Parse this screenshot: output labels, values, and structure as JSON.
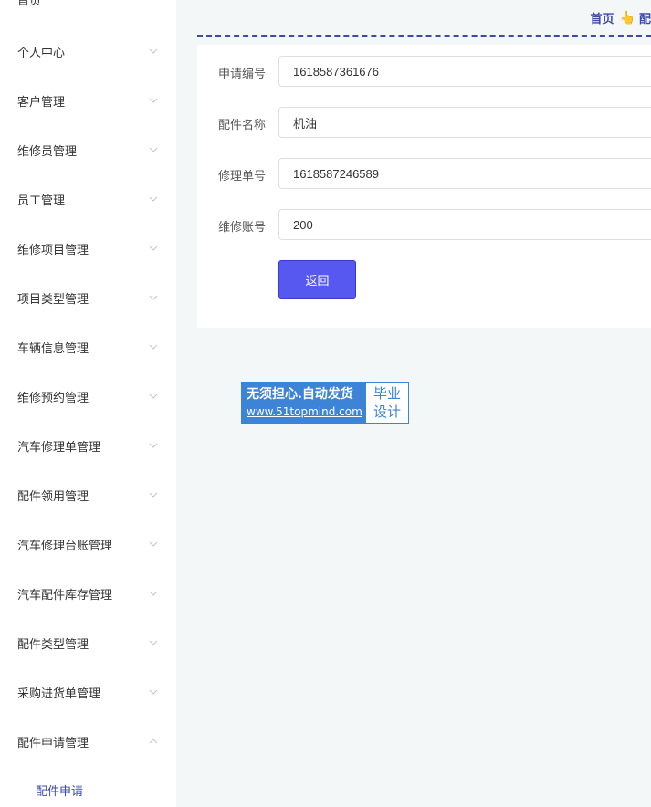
{
  "sidebar": {
    "top_label": "首页",
    "items": [
      {
        "label": "个人中心",
        "expanded": false
      },
      {
        "label": "客户管理",
        "expanded": false
      },
      {
        "label": "维修员管理",
        "expanded": false
      },
      {
        "label": "员工管理",
        "expanded": false
      },
      {
        "label": "维修项目管理",
        "expanded": false
      },
      {
        "label": "项目类型管理",
        "expanded": false
      },
      {
        "label": "车辆信息管理",
        "expanded": false
      },
      {
        "label": "维修预约管理",
        "expanded": false
      },
      {
        "label": "汽车修理单管理",
        "expanded": false
      },
      {
        "label": "配件领用管理",
        "expanded": false
      },
      {
        "label": "汽车修理台账管理",
        "expanded": false
      },
      {
        "label": "汽车配件库存管理",
        "expanded": false
      },
      {
        "label": "配件类型管理",
        "expanded": false
      },
      {
        "label": "采购进货单管理",
        "expanded": false
      },
      {
        "label": "配件申请管理",
        "expanded": true
      }
    ],
    "sub_item": "配件申请"
  },
  "breadcrumb": {
    "home": "首页",
    "hand": "👆",
    "next": "配"
  },
  "form": {
    "fields": [
      {
        "label": "申请编号",
        "value": "1618587361676"
      },
      {
        "label": "配件名称",
        "value": "机油"
      },
      {
        "label": "修理单号",
        "value": "1618587246589"
      },
      {
        "label": "维修账号",
        "value": "200"
      }
    ],
    "back_label": "返回"
  },
  "watermark": {
    "line1": "无须担心.自动发货",
    "line2": "www.51topmind.com",
    "right1": "毕业",
    "right2": "设计"
  },
  "colors": {
    "accent": "#3c4aa8",
    "button": "#5758f0",
    "background": "#f3f7f8",
    "watermark": "#3d84d6"
  }
}
